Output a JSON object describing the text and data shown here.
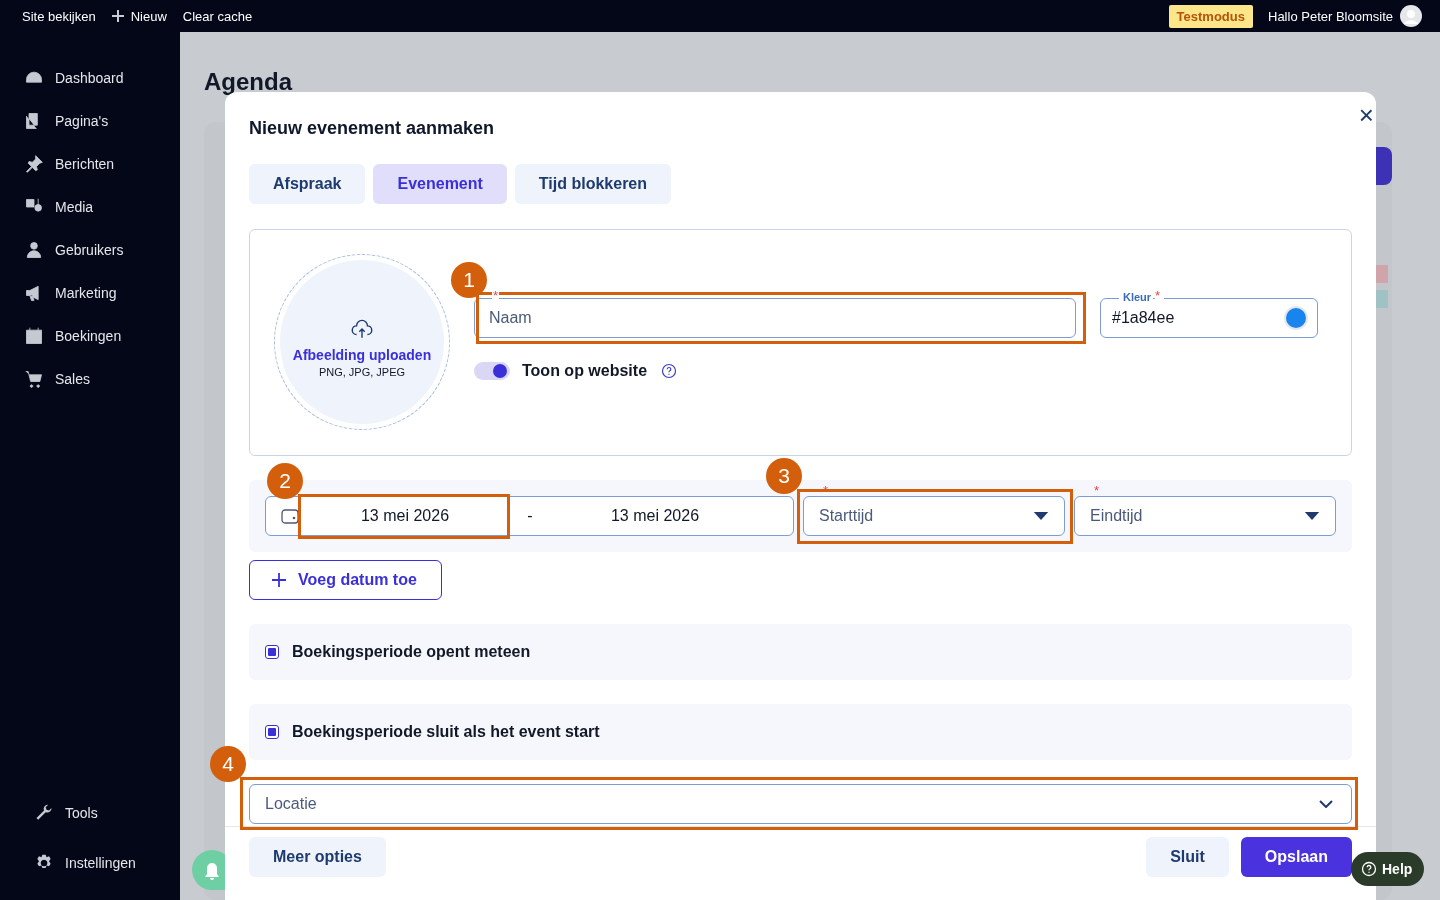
{
  "topbar": {
    "links": [
      {
        "label": "Site bekijken",
        "kind": "link"
      },
      {
        "label": "Nieuw",
        "kind": "new"
      },
      {
        "label": "Clear cache",
        "kind": "link"
      }
    ],
    "badge": "Testmodus",
    "greeting": "Hallo Peter Bloomsite"
  },
  "sidebar": {
    "items": [
      {
        "label": "Dashboard"
      },
      {
        "label": "Pagina's"
      },
      {
        "label": "Berichten"
      },
      {
        "label": "Media"
      },
      {
        "label": "Gebruikers"
      },
      {
        "label": "Marketing"
      },
      {
        "label": "Boekingen"
      },
      {
        "label": "Sales"
      }
    ],
    "bottom_items": [
      {
        "label": "Tools"
      },
      {
        "label": "Instellingen"
      }
    ]
  },
  "page_title": "Agenda",
  "modal": {
    "title": "Nieuw evenement aanmaken",
    "close": "×",
    "tabs": [
      {
        "label": "Afspraak",
        "selected": false
      },
      {
        "label": "Evenement",
        "selected": true
      },
      {
        "label": "Tijd blokkeren",
        "selected": false
      }
    ],
    "upload": {
      "title": "Afbeelding uploaden",
      "formats": "PNG, JPG, JPEG"
    },
    "name_field": {
      "placeholder": "Naam",
      "required_mark": "*"
    },
    "color_field": {
      "label": "Kleur",
      "required_mark": "*",
      "value": "#1a84ee",
      "color": "#1a84ee"
    },
    "toggle": {
      "label": "Toon op website",
      "on": true
    },
    "date_range": {
      "start": "13 mei 2026",
      "separator": "-",
      "end": "13 mei 2026"
    },
    "time_selects": [
      {
        "placeholder": "Starttijd",
        "required_mark": "*"
      },
      {
        "placeholder": "Eindtijd",
        "required_mark": "*"
      }
    ],
    "add_date_button": "Voeg datum toe",
    "checkboxes": [
      {
        "label": "Boekingsperiode opent meteen",
        "checked": true
      },
      {
        "label": "Boekingsperiode sluit als het event start",
        "checked": true
      }
    ],
    "location_select": {
      "placeholder": "Locatie"
    },
    "footer": {
      "more": "Meer opties",
      "close": "Sluit",
      "save": "Opslaan"
    }
  },
  "annotations": [
    {
      "number": "1"
    },
    {
      "number": "2"
    },
    {
      "number": "3"
    },
    {
      "number": "4"
    }
  ],
  "help_button": "Help"
}
